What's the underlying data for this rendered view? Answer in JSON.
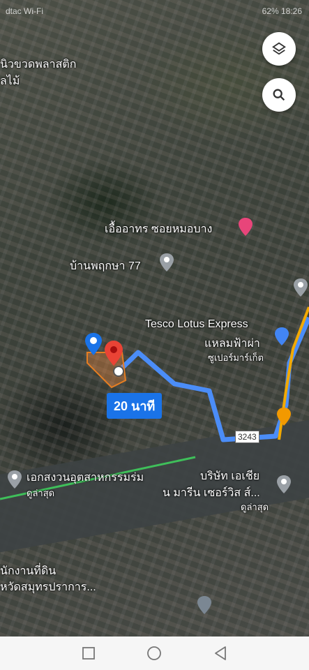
{
  "status_bar": {
    "carrier": "dtac Wi-Fi",
    "battery": "62",
    "time": "18:26"
  },
  "controls": {
    "layers_icon": "layers-icon",
    "search_icon": "search-icon"
  },
  "places": [
    {
      "id": "plastic",
      "text": "นิวขวดพลาสติก"
    },
    {
      "id": "plastic2",
      "text": "ลไม้"
    },
    {
      "id": "apartment",
      "text": "เอื้ออาทร ซอยหมอบาง"
    },
    {
      "id": "village",
      "text": "บ้านพฤกษา 77"
    },
    {
      "id": "tesco1",
      "text": "Tesco Lotus Express"
    },
    {
      "id": "tesco2",
      "text": "แหลมฟ้าผ่า"
    },
    {
      "id": "tesco3",
      "text": "ซูเปอร์มาร์เก็ต"
    },
    {
      "id": "industrial1",
      "text": "เอกสงวนอุตสาหกรรมร่ม"
    },
    {
      "id": "industrial2",
      "text": "ดูล่าสุด"
    },
    {
      "id": "company1",
      "text": "บริษัท เอเชีย"
    },
    {
      "id": "company2",
      "text": "น มารีน เซอร์วิส ส์..."
    },
    {
      "id": "company3",
      "text": "ดูล่าสุด"
    },
    {
      "id": "landoffice1",
      "text": "นักงานที่ดิน"
    },
    {
      "id": "landoffice2",
      "text": "หวัดสมุทรปราการ..."
    }
  ],
  "route": {
    "duration": "20 นาที",
    "road_number": "3243"
  },
  "nav_icons": [
    "recent-apps-icon",
    "home-icon",
    "back-icon"
  ]
}
